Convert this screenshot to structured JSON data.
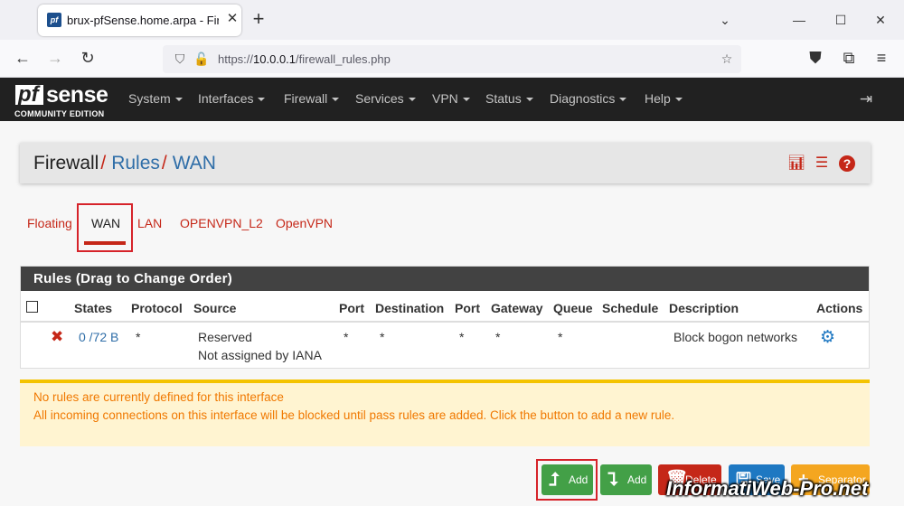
{
  "browser": {
    "tab_title": "brux-pfSense.home.arpa - Firewall: Rules: WAN",
    "favicon_text": "pf",
    "url_prefix": "https://",
    "url_host": "10.0.0.1",
    "url_path": "/firewall_rules.php"
  },
  "brand": {
    "logo_pf": "pf",
    "logo_sense": "sense",
    "edition": "COMMUNITY EDITION"
  },
  "menu": [
    "System",
    "Interfaces",
    "Firewall",
    "Services",
    "VPN",
    "Status",
    "Diagnostics",
    "Help"
  ],
  "breadcrumb": {
    "part1": "Firewall",
    "sep": "/",
    "part2": "Rules",
    "part3": "WAN"
  },
  "interface_tabs": [
    "Floating",
    "WAN",
    "LAN",
    "OPENVPN_L2",
    "OpenVPN"
  ],
  "active_tab": "WAN",
  "rules_panel": {
    "title": "Rules (Drag to Change Order)",
    "columns": [
      "States",
      "Protocol",
      "Source",
      "Port",
      "Destination",
      "Port",
      "Gateway",
      "Queue",
      "Schedule",
      "Description",
      "Actions"
    ],
    "row": {
      "states": "0 /72 B",
      "protocol": "*",
      "source_line1": "Reserved",
      "source_line2": "Not assigned by IANA",
      "src_port": "*",
      "destination": "*",
      "dst_port": "*",
      "gateway": "*",
      "queue": "*",
      "schedule": "",
      "description": "Block bogon networks"
    }
  },
  "alert": {
    "line1": "No rules are currently defined for this interface",
    "line2": "All incoming connections on this interface will be blocked until pass rules are added. Click the button to add a new rule."
  },
  "buttons": {
    "add_top": "Add",
    "add_bottom": "Add",
    "delete": "Delete",
    "save": "Save",
    "separator": "Separator"
  },
  "watermark": "InformatiWeb-Pro.net",
  "colors": {
    "pf_red": "#c52718",
    "link_blue": "#2f6ea8",
    "nav_dark": "#212121",
    "success": "#43a047",
    "danger": "#c52718",
    "primary": "#1e78c2",
    "warning": "#f4c300"
  }
}
